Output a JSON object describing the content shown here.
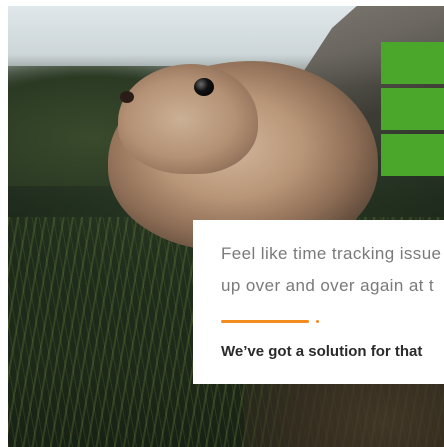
{
  "hero": {
    "headline_line1": "Feel like time tracking issue",
    "headline_line2": "up over and over again at t",
    "subheadline": "We’ve got a solution for that"
  },
  "colors": {
    "accent_green": "#4aa72c",
    "accent_orange": "#f28c1f",
    "text_gray": "#7a7a7a",
    "text_dark": "#2b2b2b"
  }
}
